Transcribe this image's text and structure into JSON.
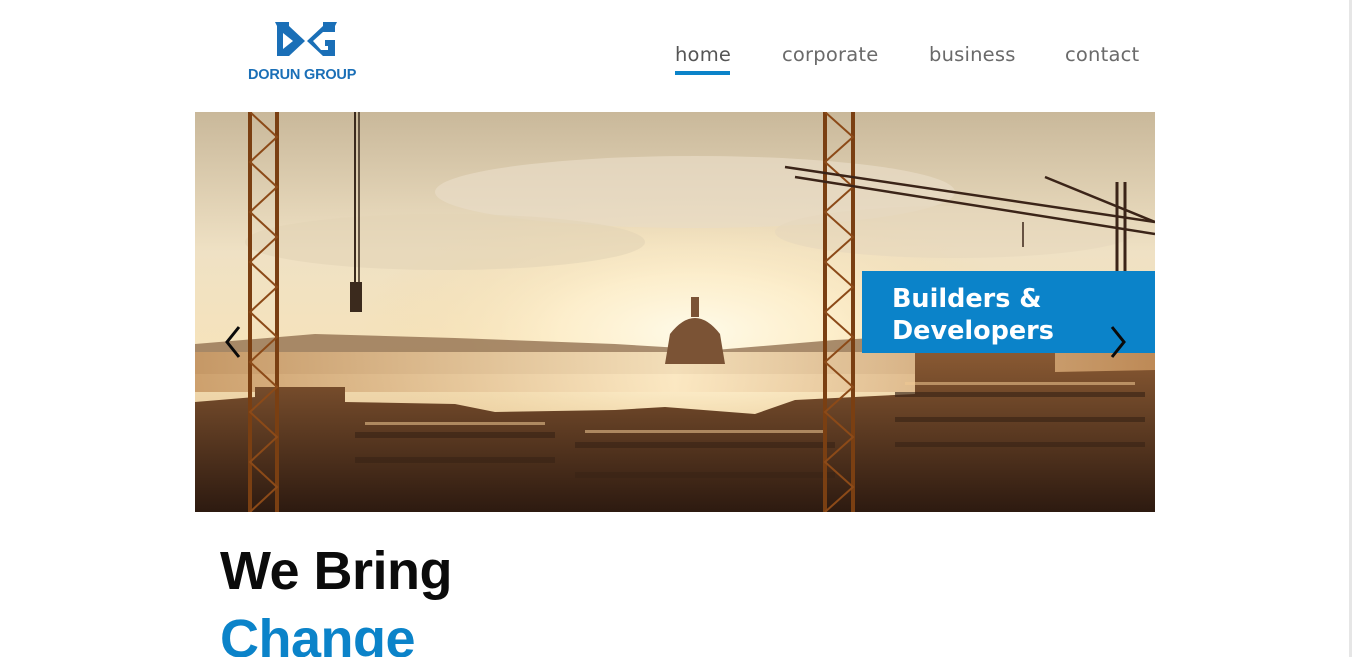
{
  "brand": {
    "name": "DORUN GROUP",
    "logo_icon": "dg-monogram-icon",
    "color": "#1a6fb7"
  },
  "nav": {
    "items": [
      {
        "label": "home",
        "active": true
      },
      {
        "label": "corporate",
        "active": false
      },
      {
        "label": "business",
        "active": false
      },
      {
        "label": "contact",
        "active": false
      }
    ],
    "accent": "#0b83c9"
  },
  "hero": {
    "image": "construction-cranes-city-sunset",
    "badge_line1": "Builders &",
    "badge_line2": "Developers",
    "prev_icon": "chevron-left-icon",
    "next_icon": "chevron-right-icon"
  },
  "headline": {
    "line1": "We Bring",
    "line2": "Change"
  }
}
